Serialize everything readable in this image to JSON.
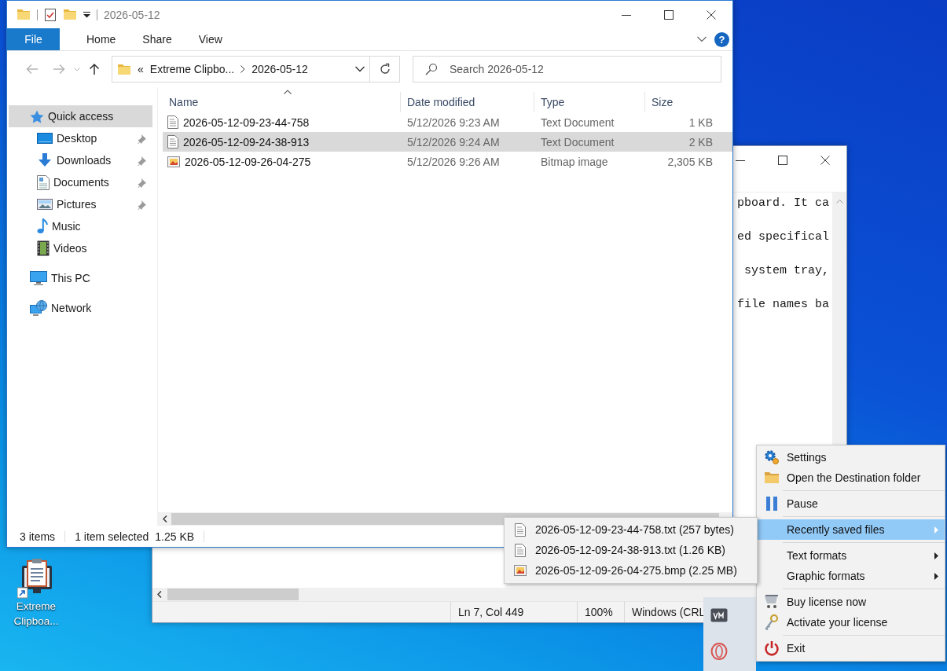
{
  "desktop": {
    "shortcut": "Extreme Clipboa..."
  },
  "notepad": {
    "lines": [
      "pboard. It ca",
      "ed specifical",
      " system tray,",
      "file names ba"
    ],
    "status": [
      "Ln 7, Col 449",
      "100%",
      "Windows (CRL"
    ]
  },
  "explorer": {
    "title": "2026-05-12",
    "ribbon_tabs": [
      {
        "label": "File",
        "kind": "file"
      },
      {
        "label": "Home",
        "kind": "tab"
      },
      {
        "label": "Share",
        "kind": "tab"
      },
      {
        "label": "View",
        "kind": "tab"
      }
    ],
    "help": "?",
    "address": {
      "overflow": "«",
      "crumbs": [
        "Extreme Clipbo...",
        "2026-05-12"
      ]
    },
    "search": {
      "placeholder": "Search 2026-05-12"
    },
    "nav": [
      {
        "label": "Quick access",
        "selected": true,
        "children": [
          {
            "label": "Desktop",
            "pinned": true,
            "selected": false
          },
          {
            "label": "Downloads",
            "pinned": true,
            "selected": false
          },
          {
            "label": "Documents",
            "pinned": true,
            "selected": false
          },
          {
            "label": "Pictures",
            "pinned": true,
            "selected": false
          },
          {
            "label": "Music",
            "pinned": false,
            "selected": false
          },
          {
            "label": "Videos",
            "pinned": false,
            "selected": false
          }
        ]
      },
      {
        "label": "This PC",
        "selected": false
      },
      {
        "label": "Network",
        "selected": false
      }
    ],
    "columns": [
      "Name",
      "Date modified",
      "Type",
      "Size"
    ],
    "files": [
      {
        "name": "2026-05-12-09-23-44-758",
        "date": "5/12/2026 9:23 AM",
        "type": "Text Document",
        "size": "1 KB",
        "kind": "text",
        "selected": false
      },
      {
        "name": "2026-05-12-09-24-38-913",
        "date": "5/12/2026 9:24 AM",
        "type": "Text Document",
        "size": "2 KB",
        "kind": "text",
        "selected": true
      },
      {
        "name": "2026-05-12-09-26-04-275",
        "date": "5/12/2026 9:26 AM",
        "type": "Bitmap image",
        "size": "2,305 KB",
        "kind": "bitmap",
        "selected": false
      }
    ],
    "status": {
      "count": "3 items",
      "selection": "1 item selected",
      "selection_size": "1.25 KB"
    }
  },
  "submenu": {
    "items": [
      {
        "label": "2026-05-12-09-23-44-758.txt (257 bytes)",
        "kind": "text"
      },
      {
        "label": "2026-05-12-09-24-38-913.txt (1.26 KB)",
        "kind": "text"
      },
      {
        "label": "2026-05-12-09-26-04-275.bmp (2.25 MB)",
        "kind": "bitmap"
      }
    ]
  },
  "tray_menu": {
    "groups": [
      [
        {
          "label": "Settings",
          "submenu": false,
          "selected": false
        },
        {
          "label": "Open the Destination folder",
          "submenu": false,
          "selected": false
        }
      ],
      [
        {
          "label": "Pause",
          "submenu": false,
          "selected": false
        }
      ],
      [
        {
          "label": "Recently saved files",
          "submenu": true,
          "selected": true
        }
      ],
      [
        {
          "label": "Text formats",
          "submenu": true,
          "selected": false
        },
        {
          "label": "Graphic formats",
          "submenu": true,
          "selected": false
        }
      ],
      [
        {
          "label": "Buy license now",
          "submenu": false,
          "selected": false
        },
        {
          "label": "Activate your license",
          "submenu": false,
          "selected": false
        }
      ],
      [
        {
          "label": "Exit",
          "submenu": false,
          "selected": false
        }
      ]
    ]
  }
}
